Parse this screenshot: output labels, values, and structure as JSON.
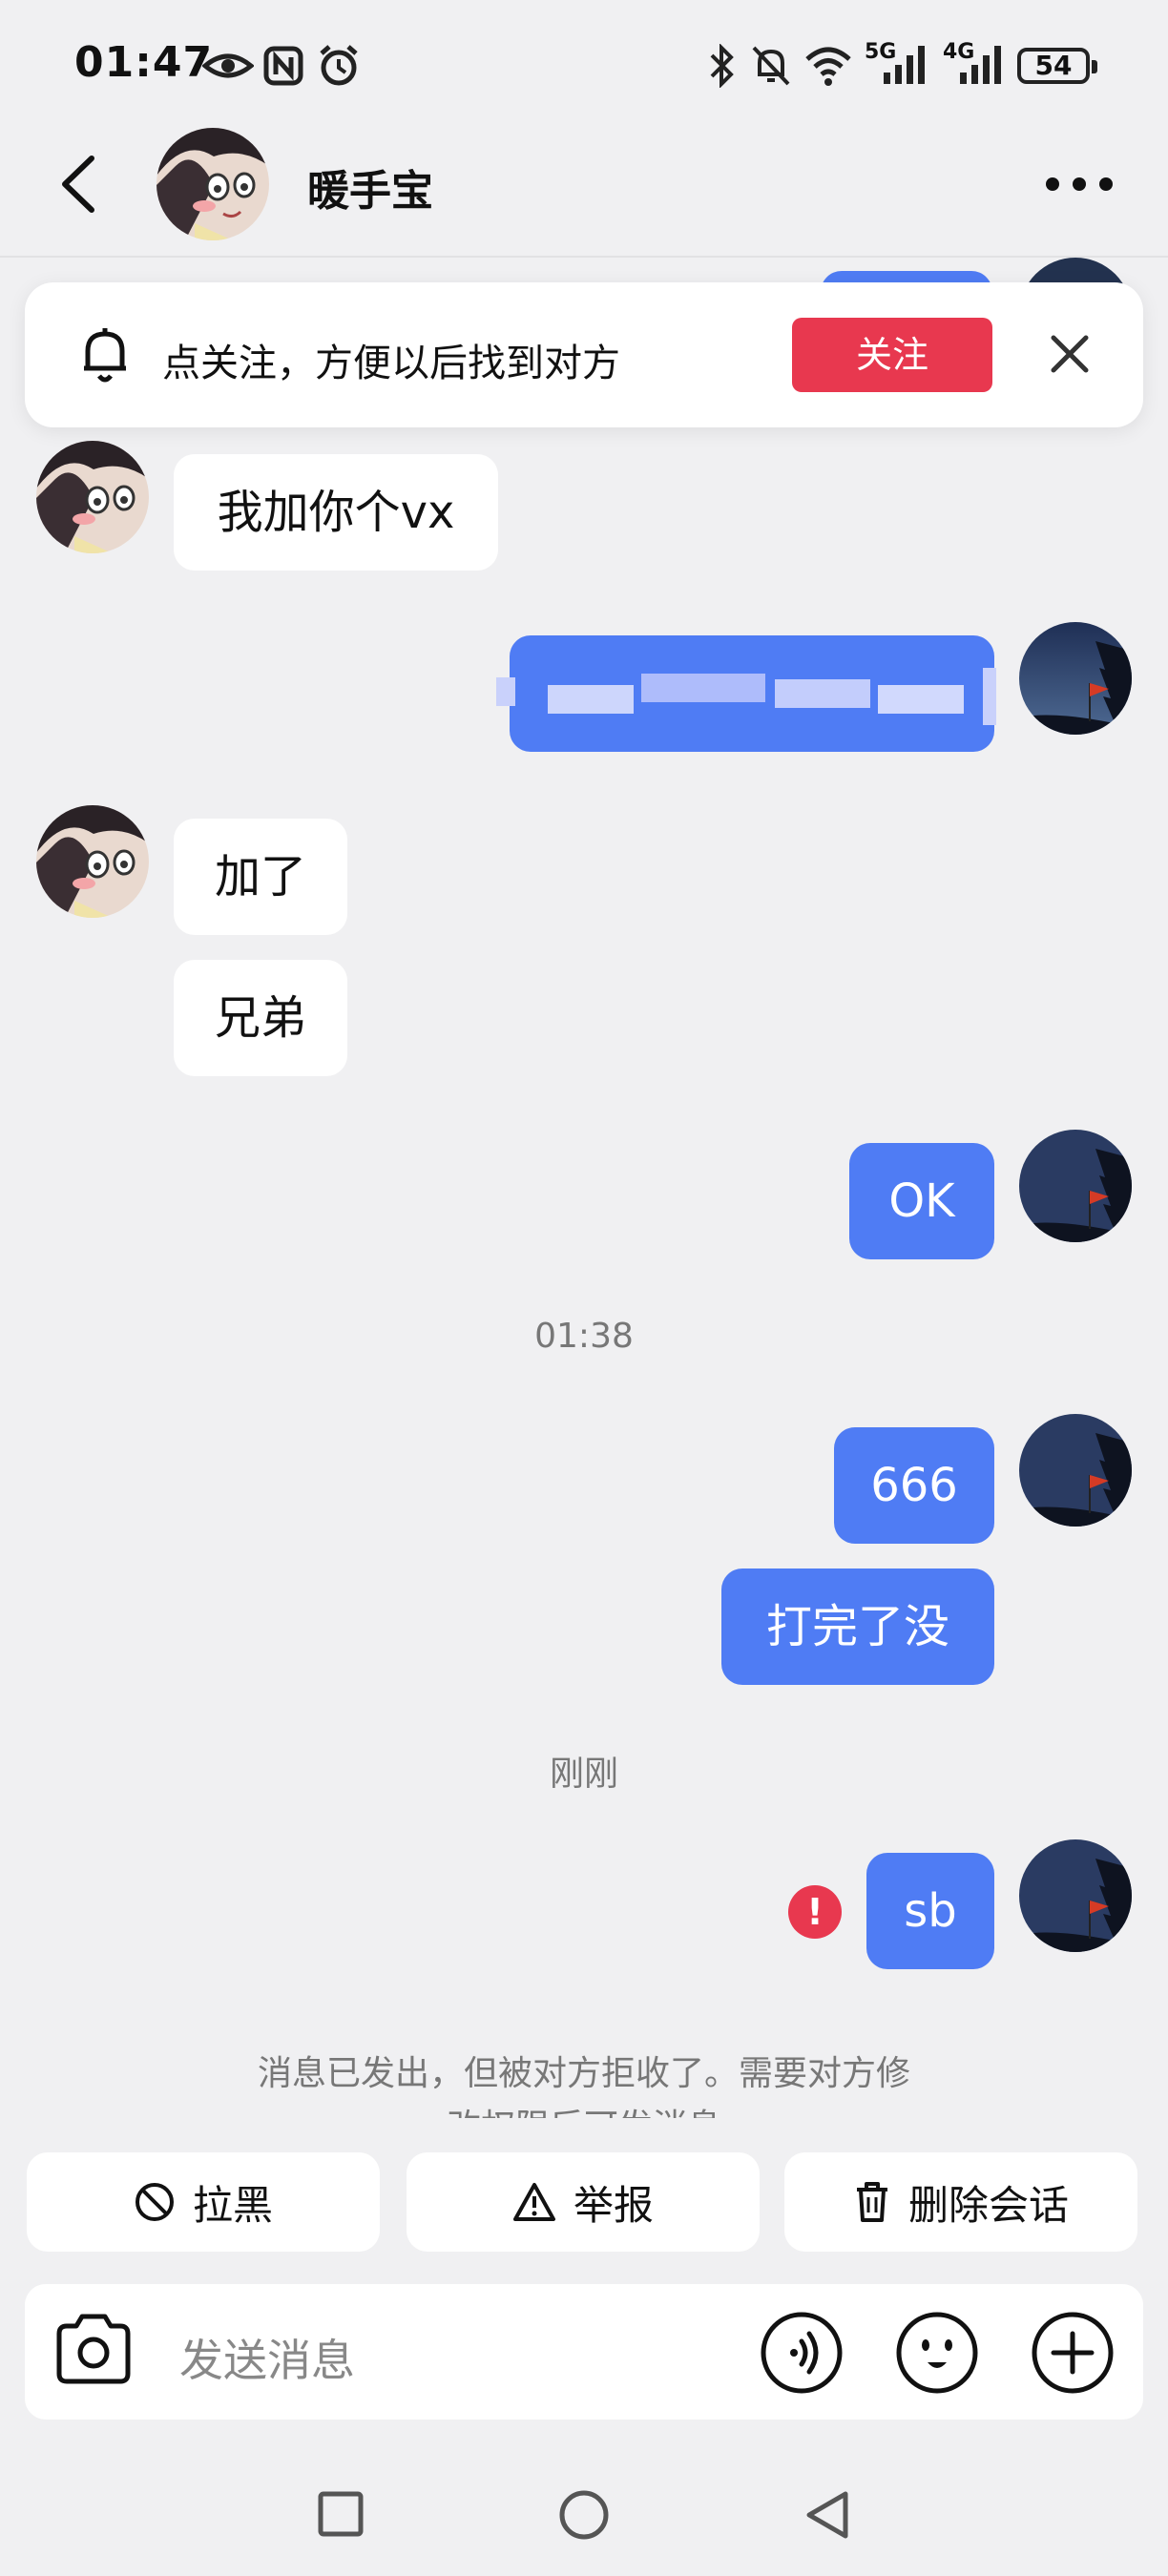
{
  "status_bar": {
    "time": "01:47",
    "signal_5g": "5G",
    "signal_4g": "4G",
    "battery": "54",
    "icons": [
      "eye-icon",
      "nfc-icon",
      "alarm-icon",
      "bluetooth-icon",
      "mute-icon",
      "wifi-icon",
      "signal-5g-icon",
      "signal-4g-icon",
      "battery-icon"
    ]
  },
  "header": {
    "title": "暖手宝",
    "icons": [
      "back-icon",
      "more-icon"
    ]
  },
  "banner": {
    "text": "点关注，方便以后找到对方",
    "follow_label": "关注",
    "icons": [
      "bell-icon",
      "close-icon"
    ]
  },
  "messages": [
    {
      "side": "in",
      "text": "我加你个vx"
    },
    {
      "side": "out",
      "text": ""
    },
    {
      "side": "in",
      "text": "加了"
    },
    {
      "side": "in",
      "text": "兄弟"
    },
    {
      "side": "out",
      "text": "OK"
    },
    {
      "side": "out",
      "text": "666"
    },
    {
      "side": "out",
      "text": "打完了没"
    },
    {
      "side": "out",
      "text": "sb",
      "failed": true
    }
  ],
  "timestamps": [
    "01:38",
    "刚刚"
  ],
  "notice": {
    "line1": "消息已发出，但被对方拒收了。需要对方修",
    "line2": "改权限后可发消息"
  },
  "actions": [
    {
      "label": "拉黑",
      "icon": "block-icon"
    },
    {
      "label": "举报",
      "icon": "warning-icon"
    },
    {
      "label": "删除会话",
      "icon": "trash-icon"
    }
  ],
  "input": {
    "placeholder": "发送消息",
    "icons": [
      "camera-icon",
      "voice-icon",
      "emoji-icon",
      "plus-icon"
    ]
  },
  "nav": {
    "icons": [
      "recent-apps-icon",
      "home-icon",
      "back-nav-icon"
    ]
  },
  "colors": {
    "background": "#f0f0f2",
    "outgoing_bubble": "#4f7cf4",
    "incoming_bubble": "#ffffff",
    "follow_button": "#e8384f",
    "error_badge": "#e8384f"
  }
}
